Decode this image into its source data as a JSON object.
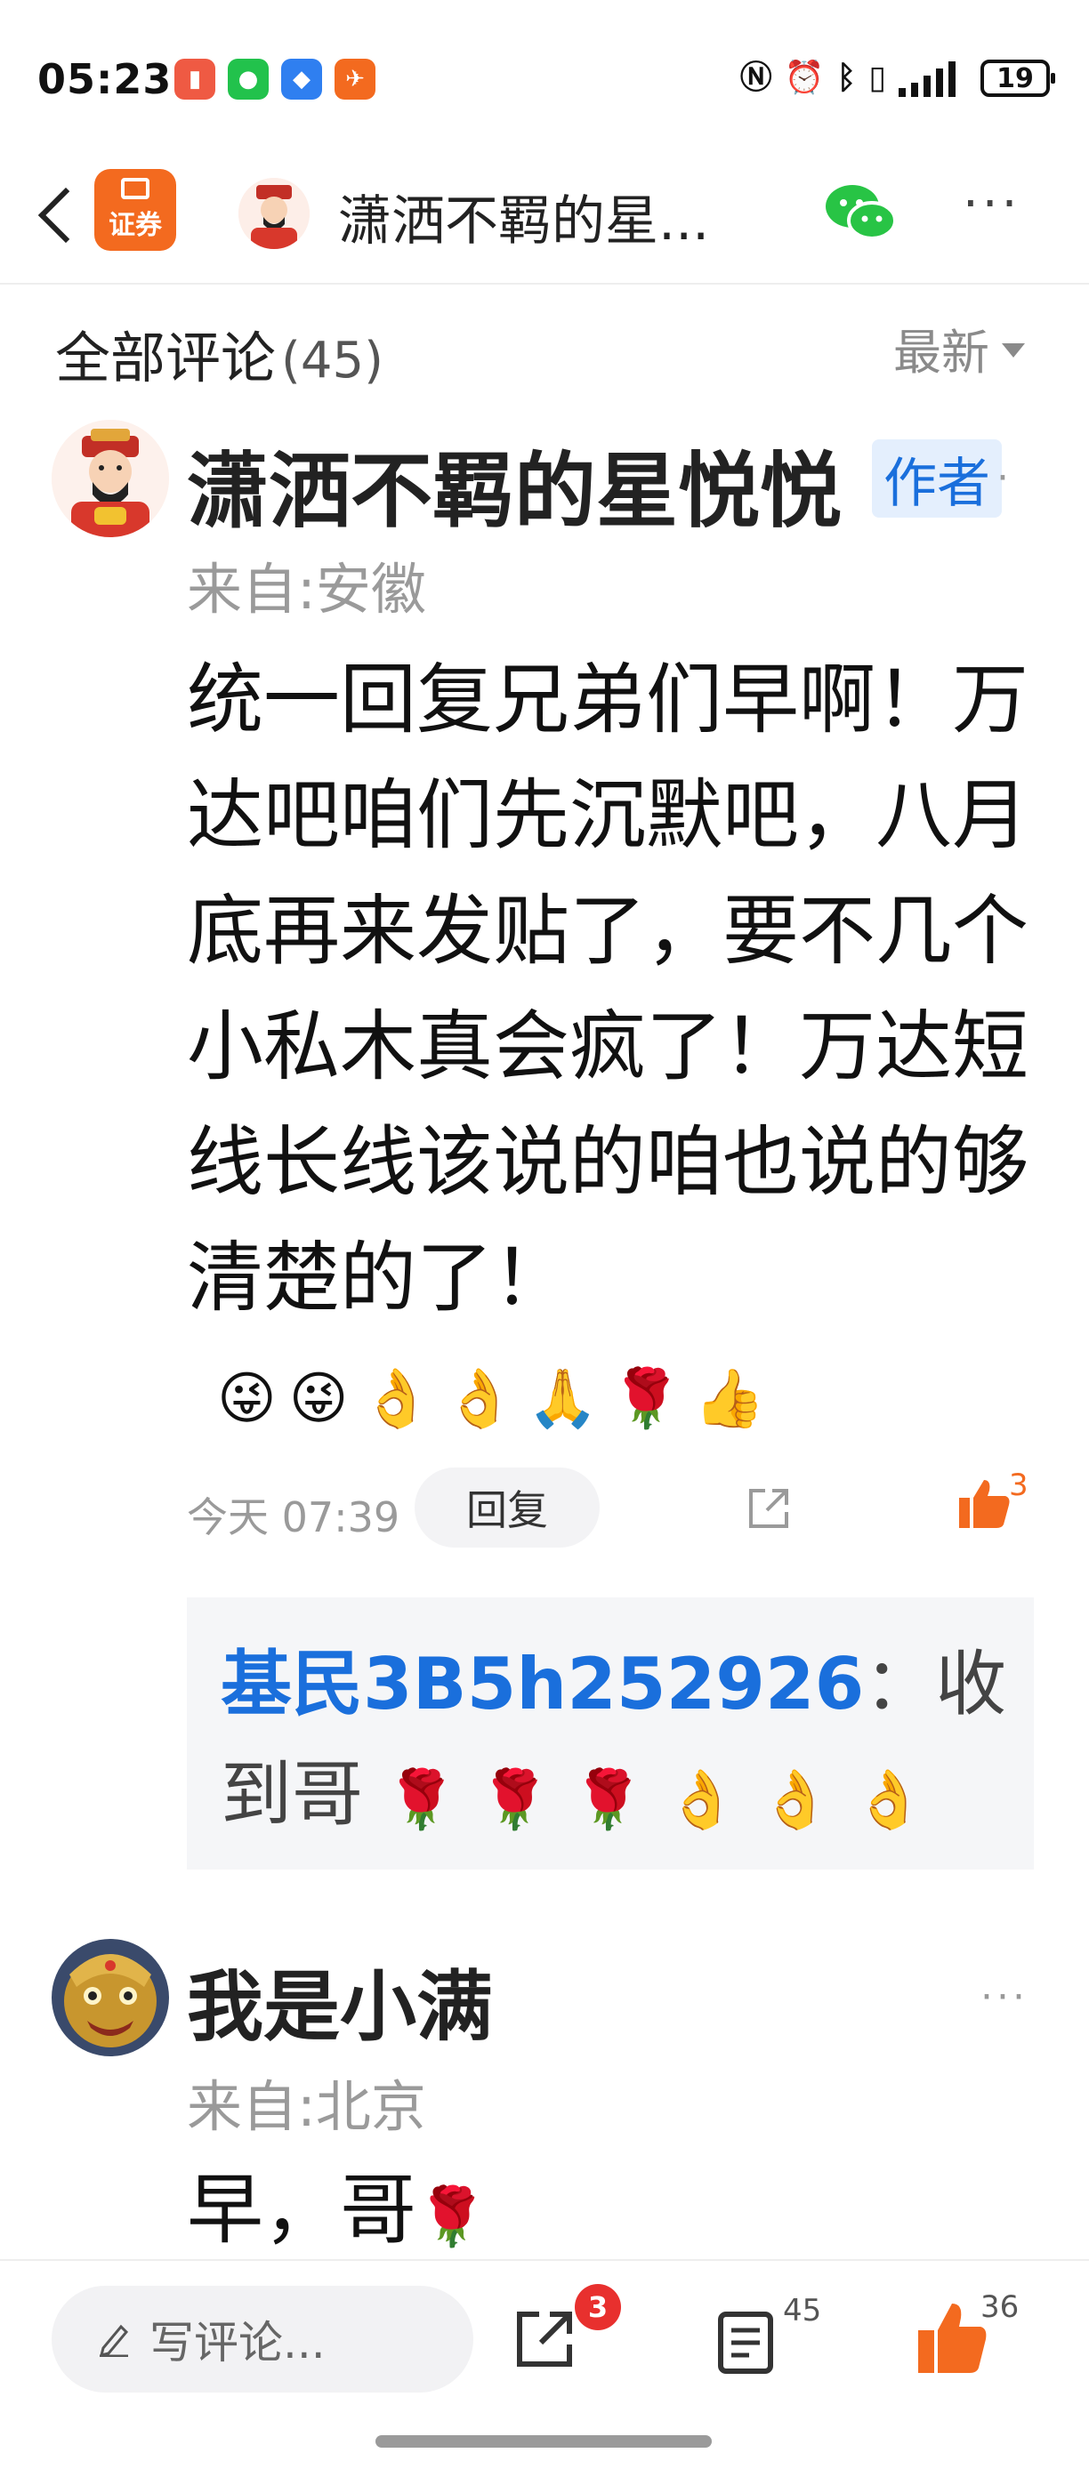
{
  "status_bar": {
    "time": "05:23",
    "battery": "19",
    "apps": [
      "video-recorder-icon",
      "wechat-icon",
      "security-icon",
      "fly-app-icon"
    ],
    "right_icons": [
      "nfc-icon",
      "alarm-icon",
      "bluetooth-icon",
      "vibrate-icon",
      "signal-icon",
      "battery-icon"
    ]
  },
  "nav": {
    "logo_text": "证券",
    "title": "潇洒不羁的星...",
    "more": "···"
  },
  "section": {
    "title": "全部评论",
    "count": "(45)",
    "sort_label": "最新"
  },
  "comments": [
    {
      "name": "潇洒不羁的星悦悦",
      "badge": "作者",
      "location": "来自:安徽",
      "text": "统一回复兄弟们早啊！万达吧咱们先沉默吧，八月底再来发贴了，要不几个小私木真会疯了！万达短线长线该说的咱也说的够清楚的了！",
      "emojis": [
        "😜",
        "😜",
        "👌",
        "👌",
        "🙏",
        "🌹",
        "👍"
      ],
      "time": "今天 07:39",
      "reply_label": "回复",
      "likes": "3",
      "replies": [
        {
          "user": "基民3B5h252926",
          "sep": "：",
          "text": "收到哥",
          "emojis": [
            "🌹",
            "🌹",
            "🌹",
            "👌",
            "👌",
            "👌"
          ]
        }
      ]
    },
    {
      "name": "我是小满",
      "location": "来自:北京",
      "text": "早，哥",
      "emojis": [
        "🌹"
      ]
    }
  ],
  "bottom_bar": {
    "placeholder": "写评论...",
    "share_badge": "3",
    "comment_count": "45",
    "like_count": "36"
  },
  "colors": {
    "accent": "#f36a1f",
    "link": "#1a6fdc",
    "badge_red": "#e8302e"
  }
}
